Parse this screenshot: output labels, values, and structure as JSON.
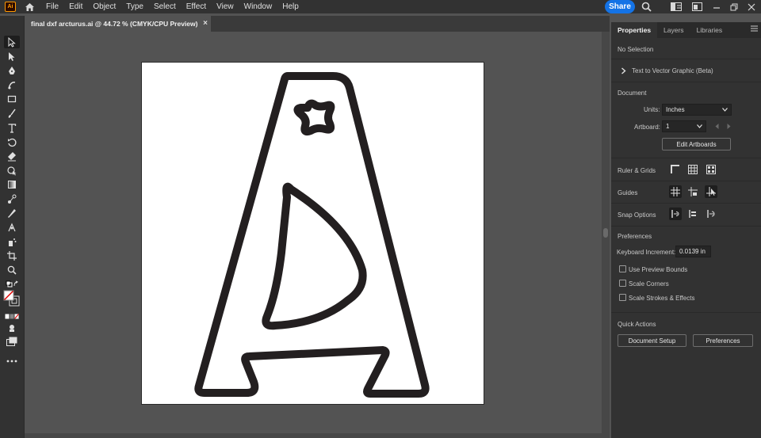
{
  "app": {
    "logo_text": "Ai"
  },
  "menu": {
    "items": [
      "File",
      "Edit",
      "Object",
      "Type",
      "Select",
      "Effect",
      "View",
      "Window",
      "Help"
    ],
    "share_label": "Share"
  },
  "document_tab": {
    "title": "final dxf arcturus.ai @ 44.72 % (CMYK/CPU Preview)",
    "close": "×"
  },
  "panel": {
    "tabs": [
      "Properties",
      "Layers",
      "Libraries"
    ],
    "no_selection": "No Selection",
    "text_to_vector": "Text to Vector Graphic (Beta)",
    "document_heading": "Document",
    "units_label": "Units:",
    "units_value": "Inches",
    "artboard_label": "Artboard:",
    "artboard_value": "1",
    "edit_artboards": "Edit Artboards",
    "ruler_grids": "Ruler & Grids",
    "guides": "Guides",
    "snap_options": "Snap Options",
    "preferences_heading": "Preferences",
    "keyboard_increment_label": "Keyboard Increment:",
    "keyboard_increment_value": "0.0139 in",
    "use_preview_bounds": "Use Preview Bounds",
    "scale_corners": "Scale Corners",
    "scale_strokes": "Scale Strokes & Effects",
    "quick_actions": "Quick Actions",
    "document_setup": "Document Setup",
    "preferences_button": "Preferences"
  },
  "colors": {
    "accent": "#1473e6",
    "panel_bg": "#323232",
    "canvas_bg": "#535353",
    "artwork_stroke": "#231f20"
  }
}
